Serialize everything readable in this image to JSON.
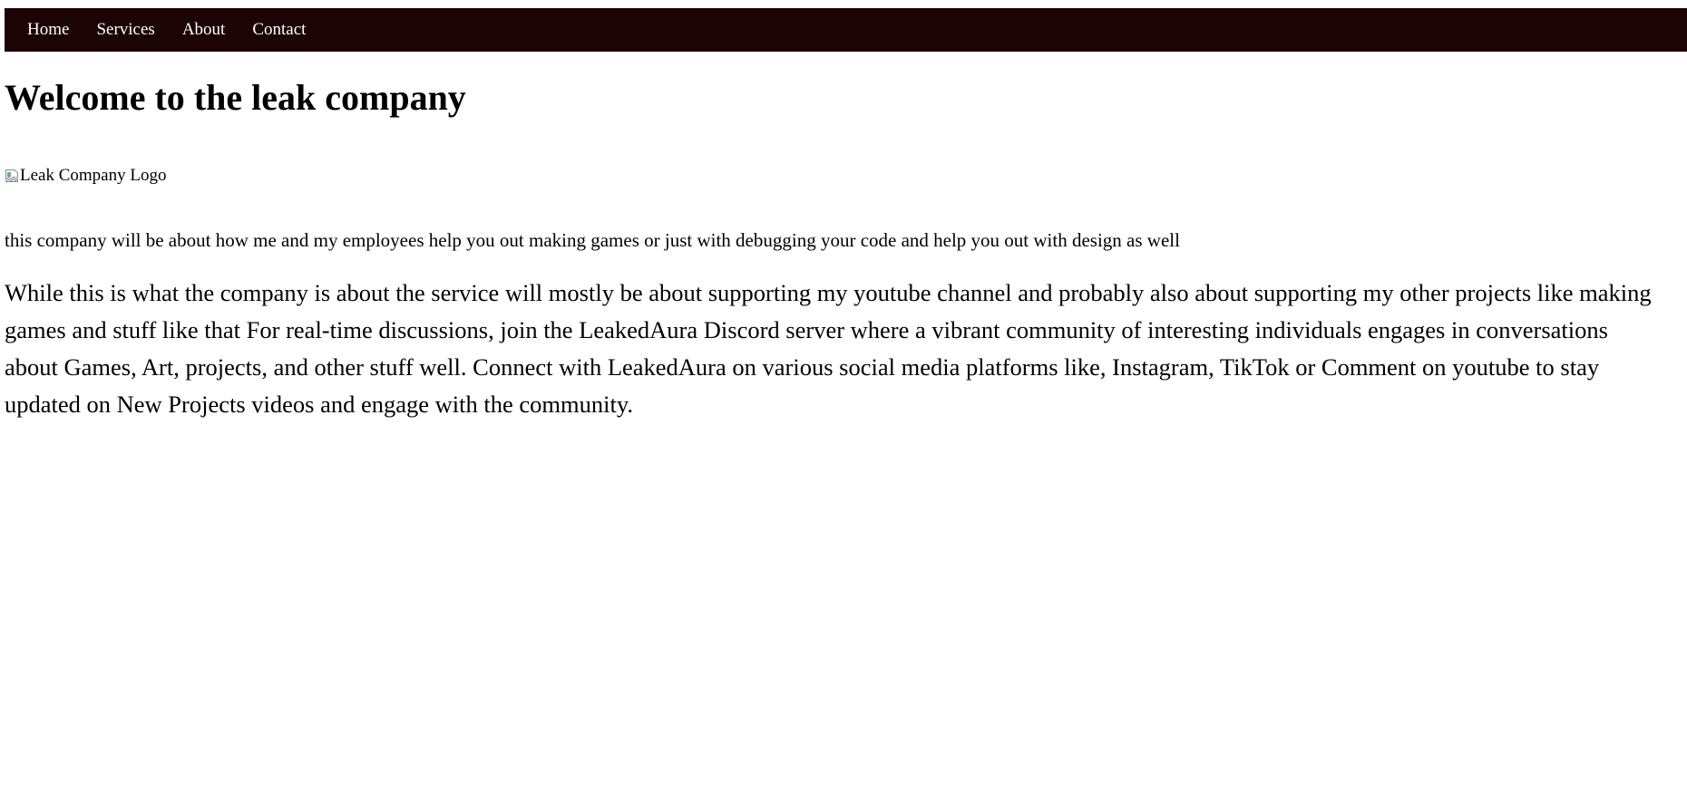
{
  "nav": {
    "items": [
      {
        "label": "Home"
      },
      {
        "label": "Services"
      },
      {
        "label": "About"
      },
      {
        "label": "Contact"
      }
    ]
  },
  "main": {
    "title": "Welcome to the leak company",
    "logo_alt": "Leak Company Logo",
    "logo_icon": "broken-image-icon",
    "intro": "this company will be about how me and my employees help you out making games or just with debugging your code and help you out with design as well",
    "body_lines": [
      "While this is what the company is about the service will mostly be about supporting my youtube channel and probably also about supporting my other projects like making",
      "games and stuff like that For real-time discussions, join the LeakedAura Discord server where a vibrant community of interesting individuals engages in conversations",
      "about Games, Art, projects, and other stuff well. Connect with LeakedAura on various social media platforms like, Instagram, TikTok or Comment on youtube to stay",
      "updated on New Projects videos and engage with the community."
    ]
  },
  "colors": {
    "navbar_bg": "#1c0404",
    "nav_text": "#ffffff",
    "page_bg": "#ffffff",
    "text": "#000000"
  }
}
